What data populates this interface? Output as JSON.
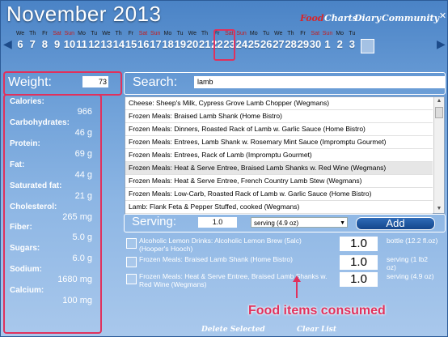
{
  "header": {
    "title": "November 2013",
    "nav": [
      {
        "label": "Food",
        "active": true
      },
      {
        "label": "Charts",
        "active": false
      },
      {
        "label": "Diary",
        "active": false
      },
      {
        "label": "Community",
        "active": false
      }
    ],
    "window_buttons": [
      "–",
      "✕"
    ]
  },
  "calendar": {
    "days": [
      {
        "name": "We",
        "num": "6",
        "weekend": false
      },
      {
        "name": "Th",
        "num": "7",
        "weekend": false
      },
      {
        "name": "Fr",
        "num": "8",
        "weekend": false
      },
      {
        "name": "Sat",
        "num": "9",
        "weekend": true
      },
      {
        "name": "Sun",
        "num": "10",
        "weekend": true
      },
      {
        "name": "Mo",
        "num": "11",
        "weekend": false
      },
      {
        "name": "Tu",
        "num": "12",
        "weekend": false
      },
      {
        "name": "We",
        "num": "13",
        "weekend": false
      },
      {
        "name": "Th",
        "num": "14",
        "weekend": false
      },
      {
        "name": "Fr",
        "num": "15",
        "weekend": false
      },
      {
        "name": "Sat",
        "num": "16",
        "weekend": true
      },
      {
        "name": "Sun",
        "num": "17",
        "weekend": true
      },
      {
        "name": "Mo",
        "num": "18",
        "weekend": false
      },
      {
        "name": "Tu",
        "num": "19",
        "weekend": false
      },
      {
        "name": "We",
        "num": "20",
        "weekend": false
      },
      {
        "name": "Th",
        "num": "21",
        "weekend": false
      },
      {
        "name": "Fr",
        "num": "22",
        "weekend": false
      },
      {
        "name": "Sat",
        "num": "23",
        "weekend": true
      },
      {
        "name": "Sun",
        "num": "24",
        "weekend": true
      },
      {
        "name": "Mo",
        "num": "25",
        "weekend": false
      },
      {
        "name": "Tu",
        "num": "26",
        "weekend": false
      },
      {
        "name": "We",
        "num": "27",
        "weekend": false
      },
      {
        "name": "Th",
        "num": "28",
        "weekend": false
      },
      {
        "name": "Fr",
        "num": "29",
        "weekend": false
      },
      {
        "name": "Sat",
        "num": "30",
        "weekend": true
      },
      {
        "name": "Sun",
        "num": "1",
        "weekend": true
      },
      {
        "name": "Mo",
        "num": "2",
        "weekend": false
      },
      {
        "name": "Tu",
        "num": "3",
        "weekend": false
      }
    ],
    "selected_day": "20"
  },
  "weight": {
    "label": "Weight:",
    "value": "73"
  },
  "search": {
    "label": "Search:",
    "value": "lamb"
  },
  "nutrition": [
    {
      "label": "Calories:",
      "value": "966"
    },
    {
      "label": "Carbohydrates:",
      "value": "46 g"
    },
    {
      "label": "Protein:",
      "value": "69 g"
    },
    {
      "label": "Fat:",
      "value": "44 g"
    },
    {
      "label": "Saturated fat:",
      "value": "21 g"
    },
    {
      "label": "Cholesterol:",
      "value": "265 mg"
    },
    {
      "label": "Fiber:",
      "value": "5.0 g"
    },
    {
      "label": "Sugars:",
      "value": "6.0 g"
    },
    {
      "label": "Sodium:",
      "value": "1680 mg"
    },
    {
      "label": "Calcium:",
      "value": "100 mg"
    }
  ],
  "results": [
    "Cheese: Sheep's Milk, Cypress Grove Lamb Chopper (Wegmans)",
    "Frozen Meals: Braised Lamb Shank (Home Bistro)",
    "Frozen Meals: Dinners, Roasted Rack of Lamb w. Garlic Sauce (Home Bistro)",
    "Frozen Meals: Entrees, Lamb Shank w. Rosemary Mint Sauce (Impromptu Gourmet)",
    "Frozen Meals: Entrees, Rack of Lamb (Impromptu Gourmet)",
    "Frozen Meals: Heat & Serve Entree, Braised Lamb Shanks w. Red Wine (Wegmans)",
    "Frozen Meals: Heat & Serve Entree, French Country Lamb Stew (Wegmans)",
    "Frozen Meals: Low-Carb, Roasted Rack of Lamb w. Garlic Sauce (Home Bistro)",
    "Lamb: Flank Feta & Pepper Stuffed, cooked (Wegmans)"
  ],
  "selected_result_index": 5,
  "serving": {
    "label": "Serving:",
    "qty": "1.0",
    "unit": "serving (4.9 oz)",
    "add_label": "Add"
  },
  "consumed": [
    {
      "name": "Alcoholic Lemon Drinks: Alcoholic Lemon Brew (5alc) (Hooper's Hooch)",
      "qty": "1.0",
      "unit": "bottle (12.2 fl.oz)"
    },
    {
      "name": "Frozen Meals: Braised Lamb Shank (Home Bistro)",
      "qty": "1.0",
      "unit": "serving (1 lb2 oz)"
    },
    {
      "name": "Frozen Meals: Heat & Serve Entree, Braised Lamb Shanks w. Red Wine (Wegmans)",
      "qty": "1.0",
      "unit": "serving (4.9 oz)"
    }
  ],
  "annotation": "Food items consumed",
  "footer": {
    "delete_label": "Delete Selected",
    "clear_label": "Clear List"
  },
  "colors": {
    "accent": "#e0315d",
    "nav_active": "#d7262b",
    "background": "#6ea0d8"
  }
}
